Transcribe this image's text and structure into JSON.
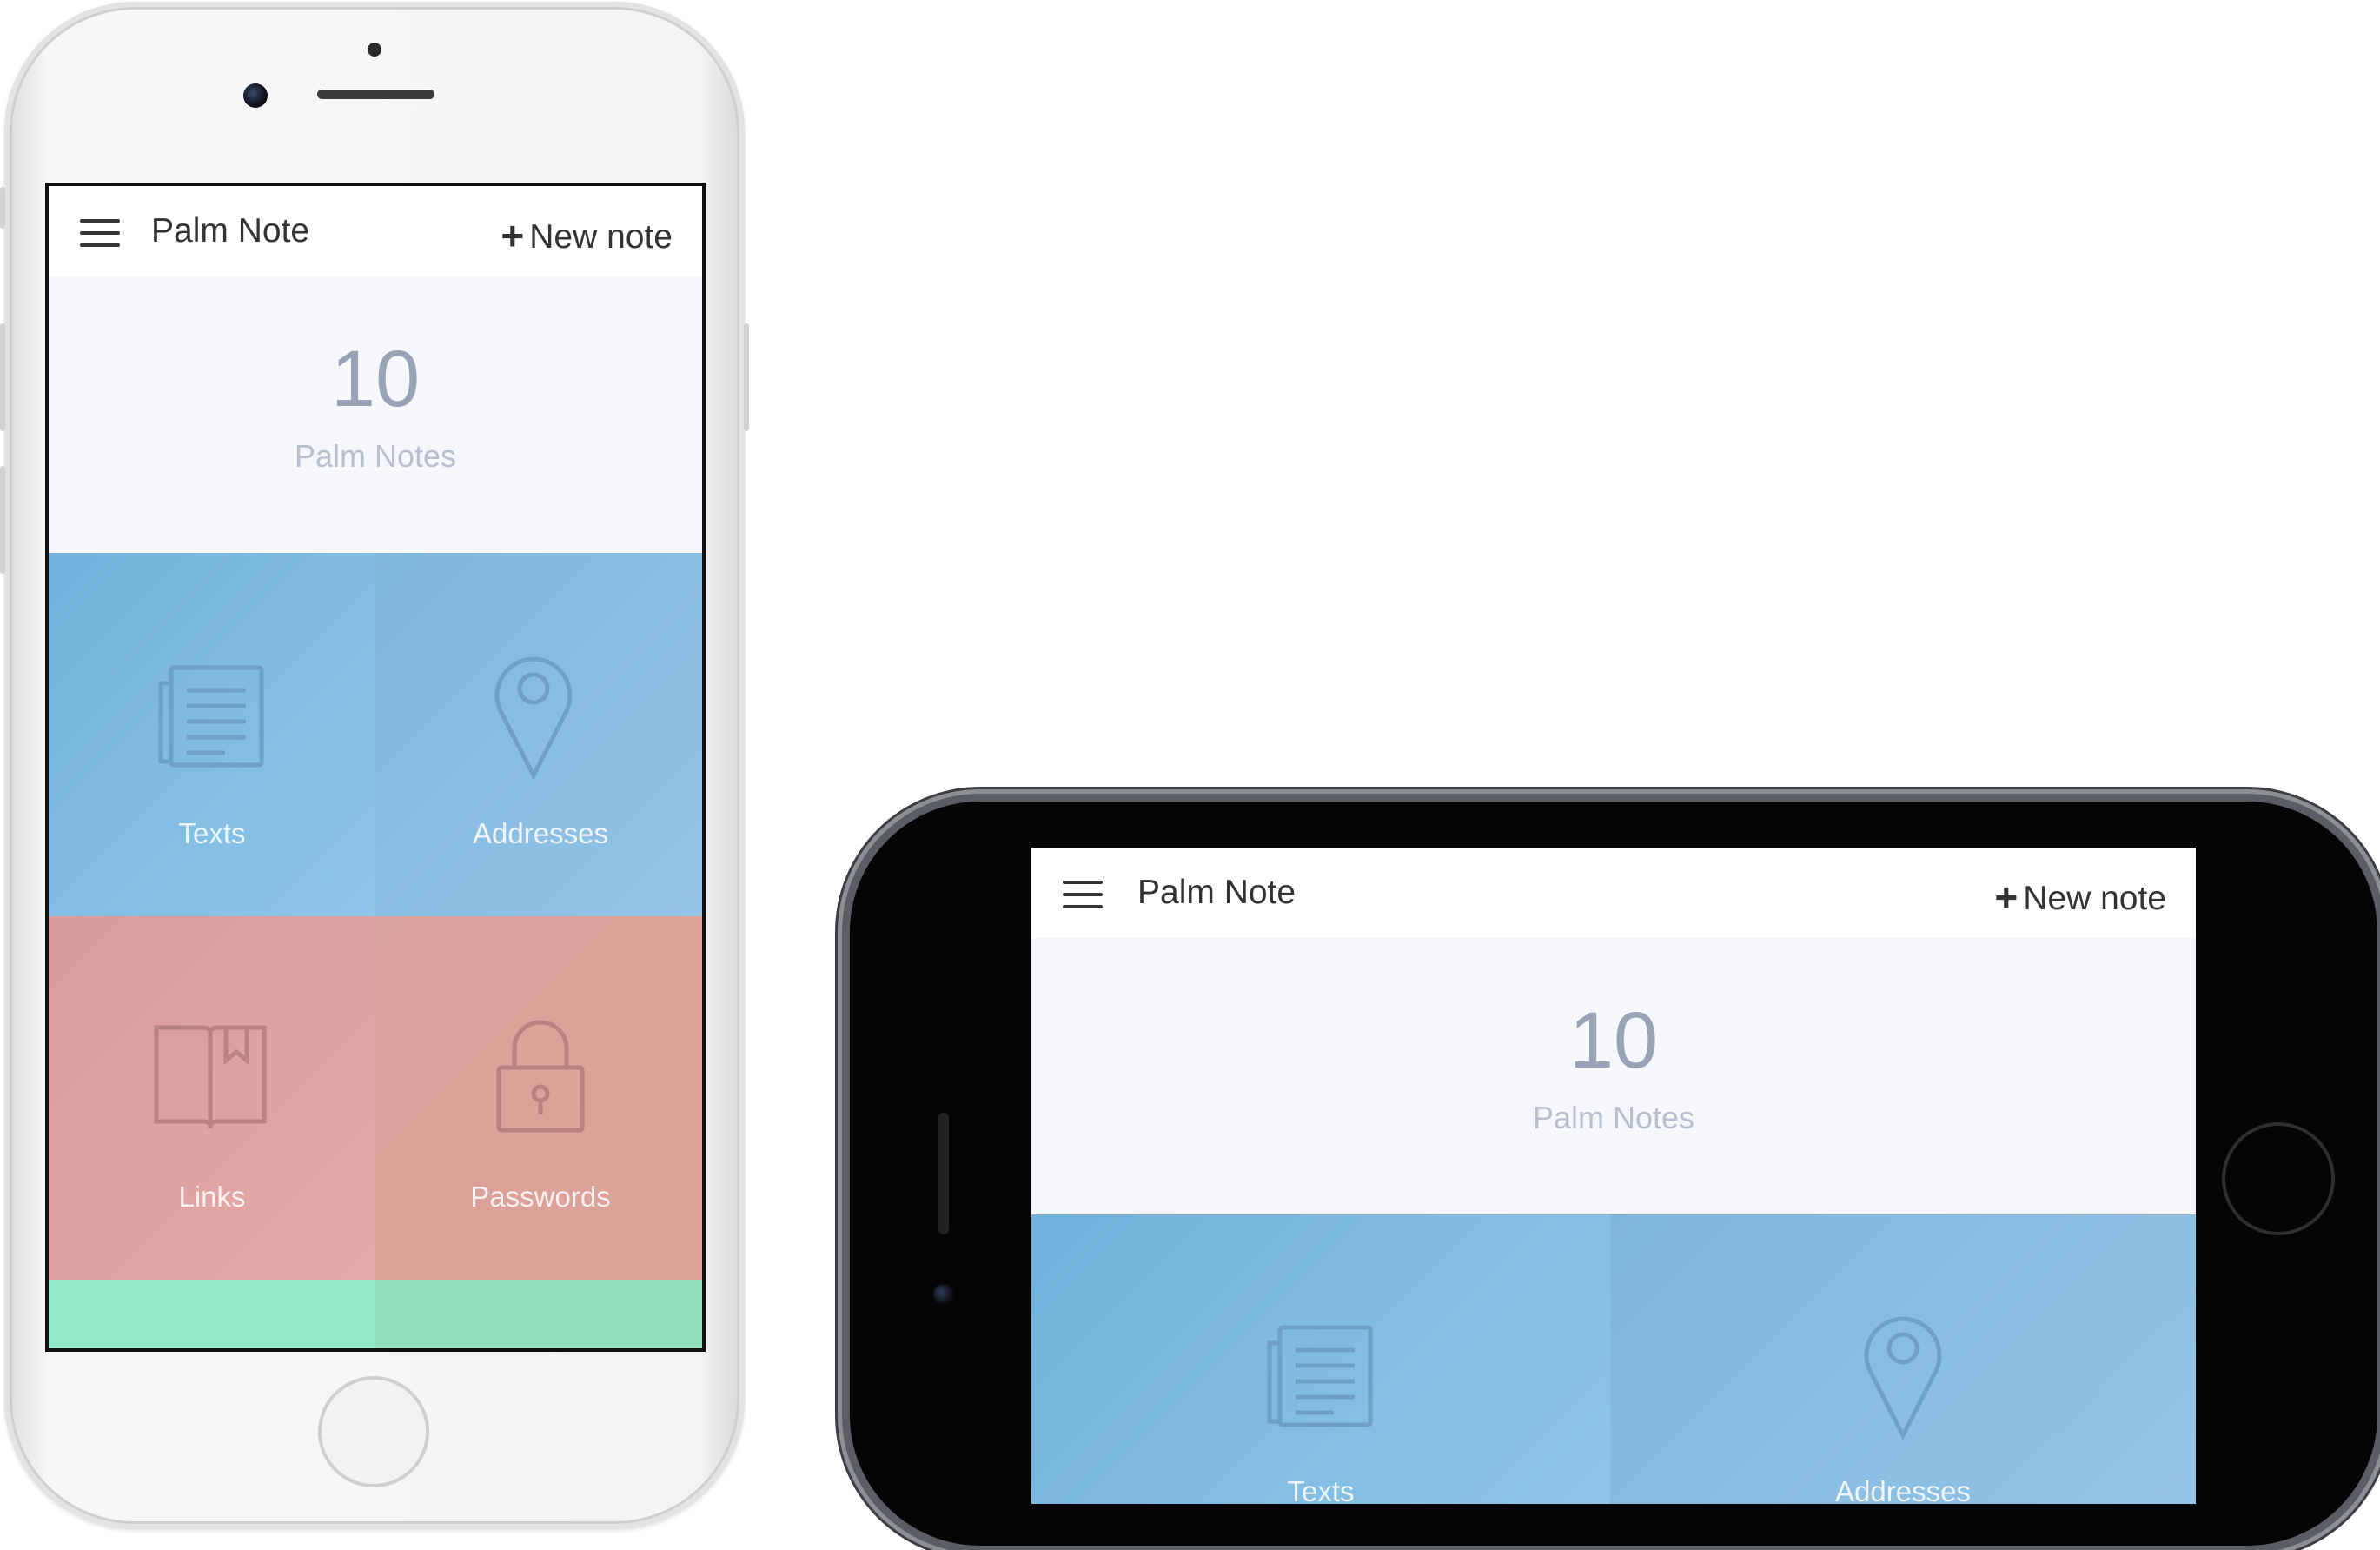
{
  "app": {
    "title": "Palm Note",
    "new_note_label": "New note",
    "new_note_icon": "plus-icon",
    "menu_icon": "hamburger-menu-icon"
  },
  "stats": {
    "count": "10",
    "label": "Palm Notes"
  },
  "categories": [
    {
      "label": "Texts",
      "icon": "document-lines-icon"
    },
    {
      "label": "Addresses",
      "icon": "map-pin-icon"
    },
    {
      "label": "Links",
      "icon": "book-bookmark-icon"
    },
    {
      "label": "Passwords",
      "icon": "padlock-icon"
    }
  ],
  "colors": {
    "blue_tile": "#7fb8de",
    "red_tile": "#dca29d",
    "green_tile": "#92e4c1",
    "stats_bg": "#f5f7fb",
    "count_text": "#9aa3b6"
  }
}
